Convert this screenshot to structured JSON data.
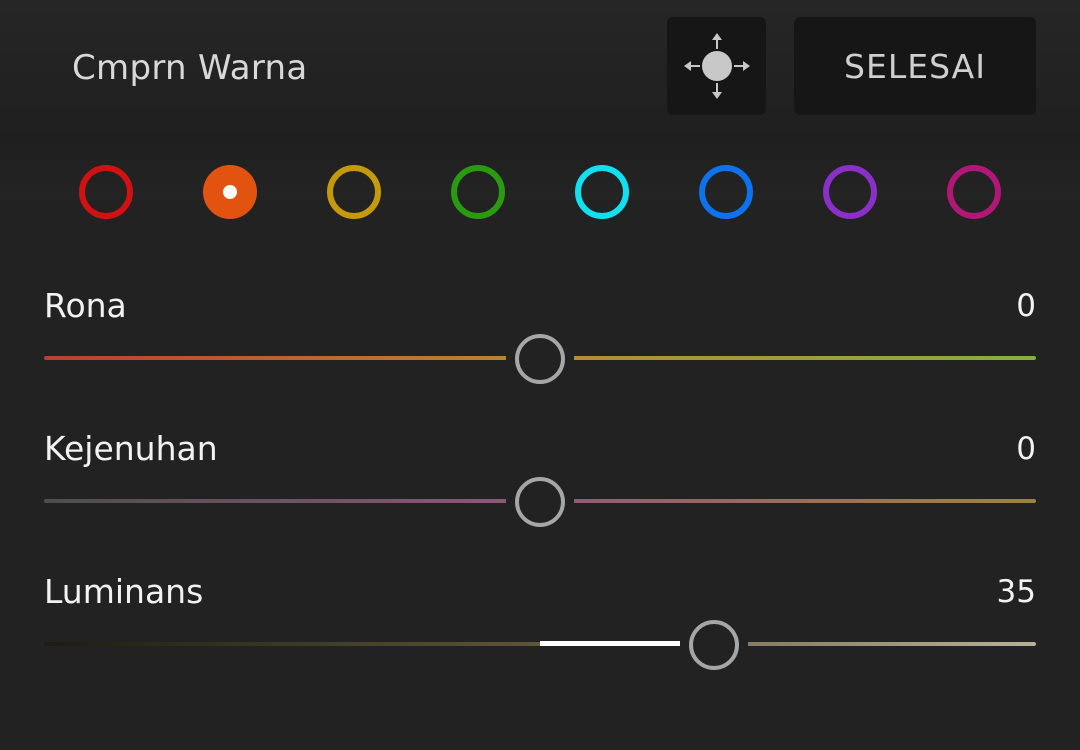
{
  "header": {
    "title": "Cmprn Warna",
    "target_icon": "targeted-adjust-icon",
    "done_label": "SELESAI"
  },
  "swatches": [
    {
      "name": "red",
      "color": "#d01212",
      "selected": false
    },
    {
      "name": "orange",
      "color": "#e35310",
      "selected": true
    },
    {
      "name": "yellow",
      "color": "#c49a0c",
      "selected": false
    },
    {
      "name": "green",
      "color": "#2a9a10",
      "selected": false
    },
    {
      "name": "aqua",
      "color": "#12e0ee",
      "selected": false
    },
    {
      "name": "blue",
      "color": "#0e72ee",
      "selected": false
    },
    {
      "name": "purple",
      "color": "#8a2fc8",
      "selected": false
    },
    {
      "name": "magenta",
      "color": "#b01777",
      "selected": false
    }
  ],
  "sliders": [
    {
      "label": "Rona",
      "value": "0",
      "numeric": 0,
      "gradient": [
        "#c23a35",
        "#b88a30",
        "#86b03e"
      ]
    },
    {
      "label": "Kejenuhan",
      "value": "0",
      "numeric": 0,
      "gradient": [
        "#4d4d4d",
        "#8e5a7a",
        "#9a8440"
      ]
    },
    {
      "label": "Luminans",
      "value": "35",
      "numeric": 35,
      "gradient": [
        "#1e1b12",
        "#5f553a",
        "#b9b09b"
      ]
    }
  ],
  "slider_range": [
    -100,
    100
  ]
}
